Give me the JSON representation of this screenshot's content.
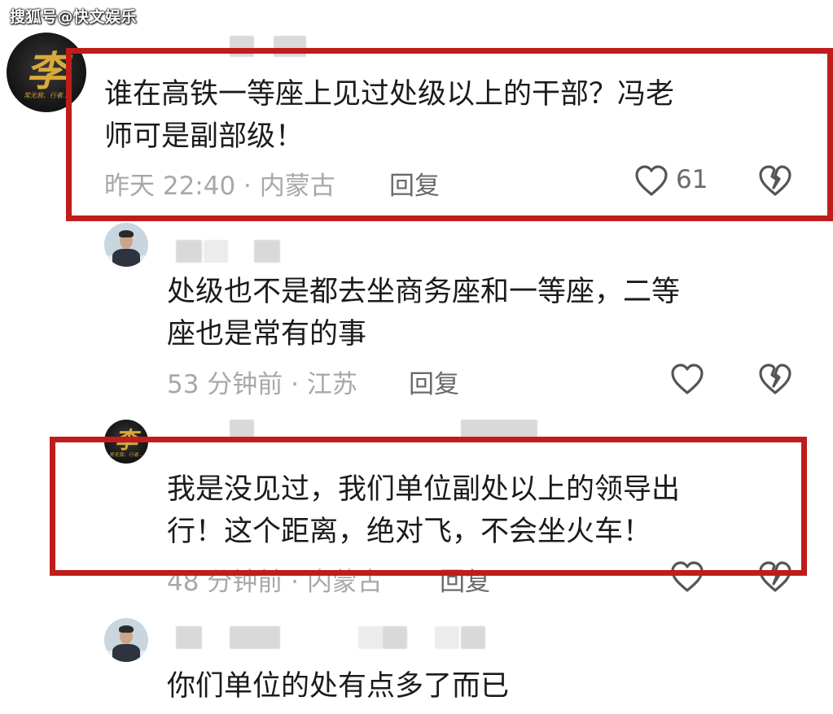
{
  "watermark": "搜狐号@快文娱乐",
  "comments": [
    {
      "avatar_char": "李",
      "avatar_tiny": "常无我、行者…",
      "text_lines": [
        "谁在高铁一等座上见过处级以上的干部？冯老",
        "师可是副部级！"
      ],
      "time_loc": "昨天 22:40 · 内蒙古",
      "reply": "回复",
      "likes": "61"
    },
    {
      "text_lines": [
        "处级也不是都去坐商务座和一等座，二等",
        "座也是常有的事"
      ],
      "time_loc": "53 分钟前 · 江苏",
      "reply": "回复"
    },
    {
      "avatar_char": "李",
      "avatar_tiny": "常无我、行者…",
      "text_lines": [
        "我是没见过，我们单位副处以上的领导出",
        "行！这个距离，绝对飞，不会坐火车！"
      ],
      "time_loc": "48 分钟前 · 内蒙古",
      "reply": "回复"
    },
    {
      "text_lines": [
        "你们单位的处有点多了而已"
      ]
    }
  ],
  "icons": {
    "like": "heart-outline-icon",
    "dislike": "broken-heart-icon"
  },
  "colors": {
    "highlight_box": "#c01c1c",
    "meta_text": "#a8a8a8",
    "reply_text": "#6a6a6a"
  }
}
